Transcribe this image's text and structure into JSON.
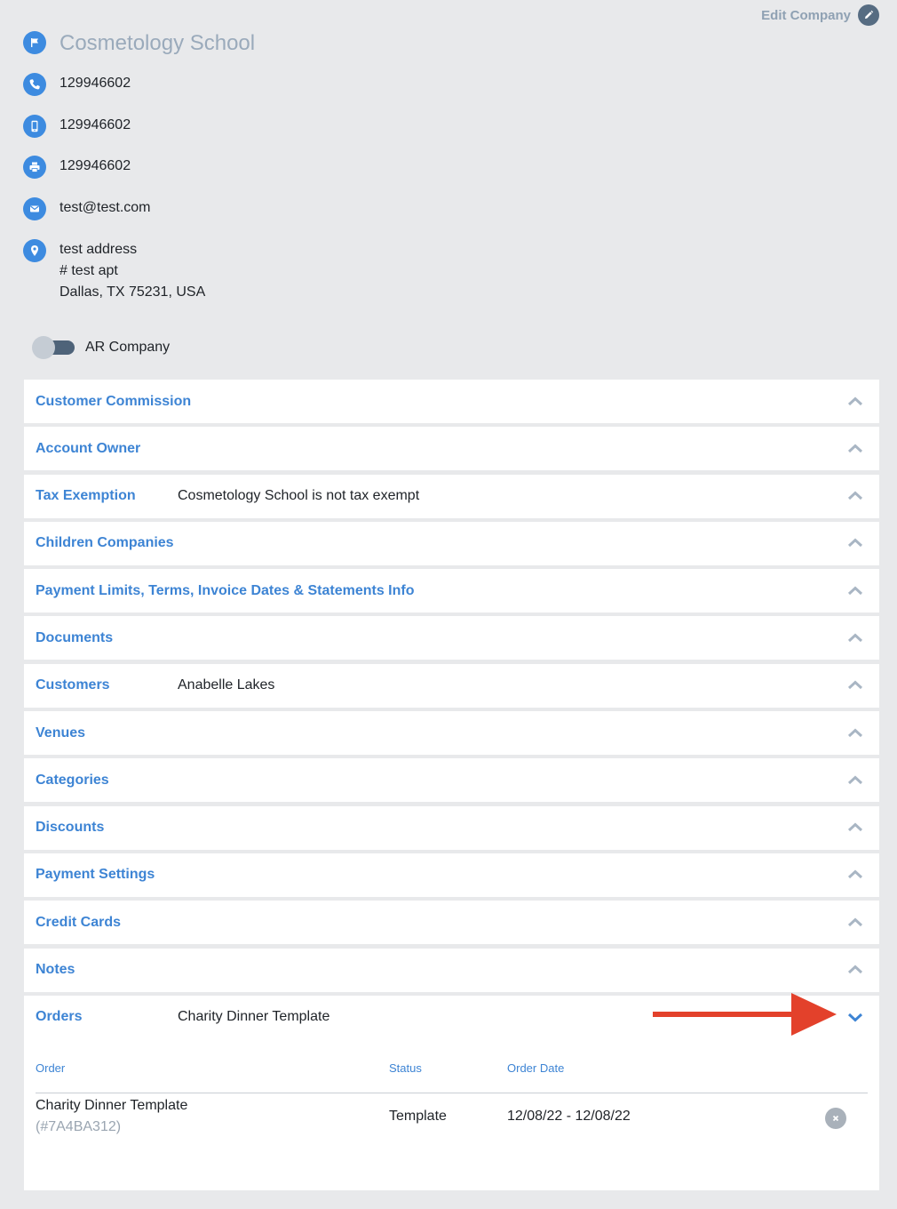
{
  "edit_company": {
    "label": "Edit Company"
  },
  "company": {
    "name": "Cosmetology School",
    "phone": "129946602",
    "mobile": "129946602",
    "fax": "129946602",
    "email": "test@test.com",
    "address_line1": "test address",
    "address_line2": "# test apt",
    "address_line3": "Dallas, TX 75231, USA"
  },
  "ar_toggle": {
    "label": "AR Company",
    "on": false
  },
  "sections": [
    {
      "title": "Customer Commission",
      "value": ""
    },
    {
      "title": "Account Owner",
      "value": ""
    },
    {
      "title": "Tax Exemption",
      "value": "Cosmetology School is not tax exempt"
    },
    {
      "title": "Children Companies",
      "value": ""
    },
    {
      "title": "Payment Limits, Terms, Invoice Dates & Statements Info",
      "value": ""
    },
    {
      "title": "Documents",
      "value": ""
    },
    {
      "title": "Customers",
      "value": "Anabelle Lakes"
    },
    {
      "title": "Venues",
      "value": ""
    },
    {
      "title": "Categories",
      "value": ""
    },
    {
      "title": "Discounts",
      "value": ""
    },
    {
      "title": "Payment Settings",
      "value": ""
    },
    {
      "title": "Credit Cards",
      "value": ""
    },
    {
      "title": "Notes",
      "value": ""
    }
  ],
  "orders": {
    "title": "Orders",
    "value": "Charity Dinner Template",
    "columns": {
      "order": "Order",
      "status": "Status",
      "order_date": "Order Date"
    },
    "rows": [
      {
        "name": "Charity Dinner Template",
        "id": "(#7A4BA312)",
        "status": "Template",
        "date": "12/08/22 - 12/08/22"
      }
    ]
  },
  "colors": {
    "background": "#e8e9eb",
    "accent_blue": "#3d84d4",
    "icon_blue": "#3d8be0",
    "annotation_red": "#e3412b"
  },
  "icons": {
    "company": "flag-icon",
    "phone": "phone-icon",
    "mobile": "mobile-icon",
    "fax": "printer-icon",
    "email": "envelope-icon",
    "address": "location-pin-icon",
    "edit": "pencil-icon",
    "collapse": "chevron-up-icon",
    "expand": "chevron-down-icon",
    "remove": "close-icon"
  }
}
